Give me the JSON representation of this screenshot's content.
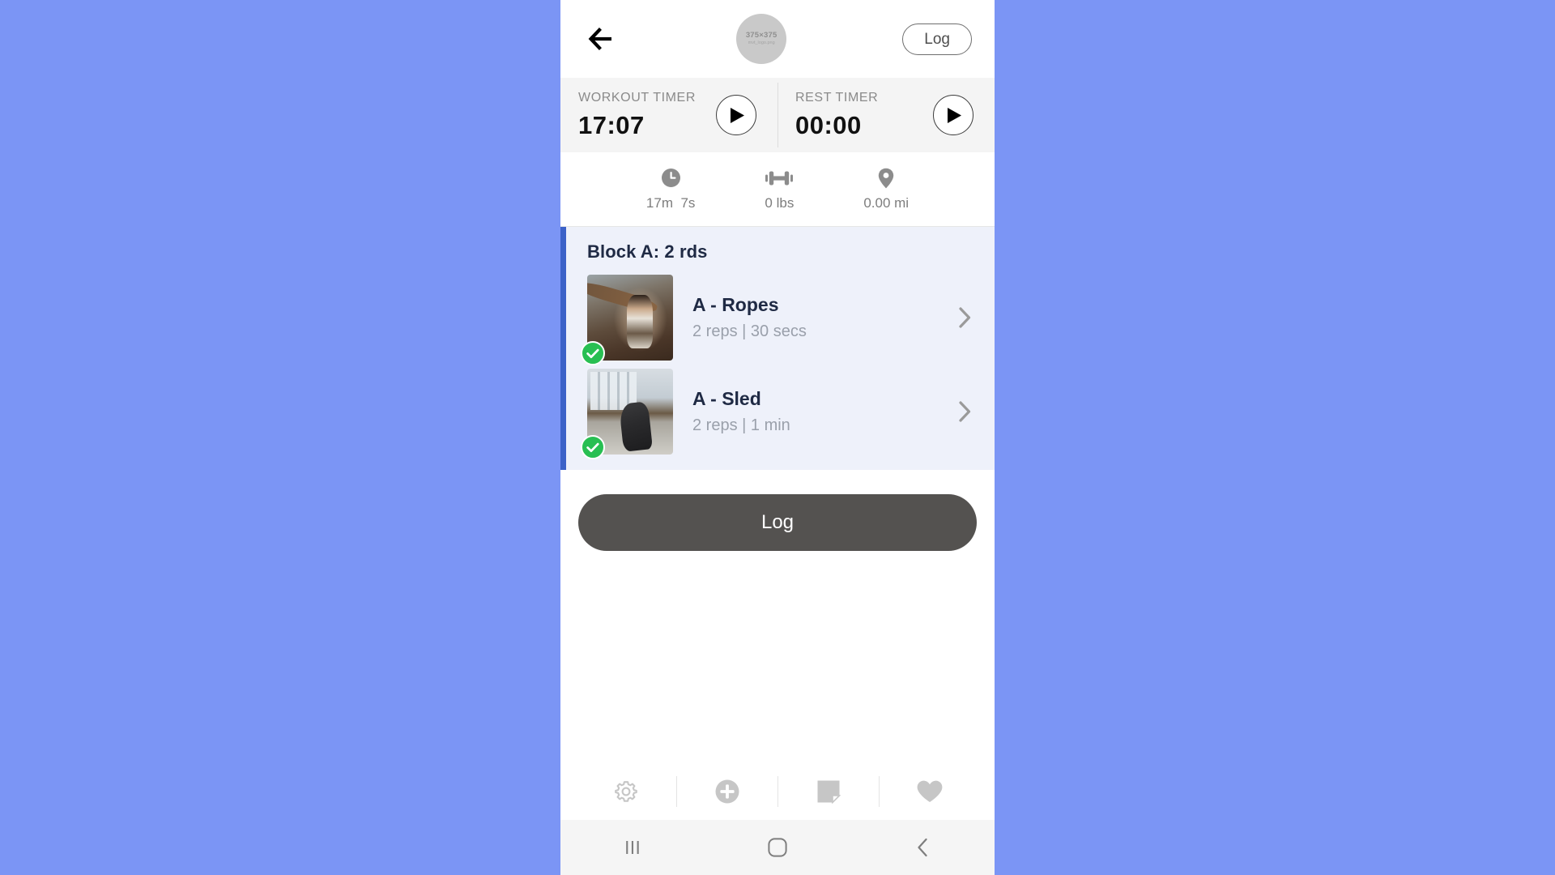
{
  "header": {
    "back_icon": "arrow-left-icon",
    "logo": {
      "dimensions": "375×375",
      "filename": "mvt_logo.png"
    },
    "log_label": "Log"
  },
  "timers": [
    {
      "label": "WORKOUT TIMER",
      "value": "17:07",
      "play_icon": "play-icon"
    },
    {
      "label": "REST TIMER",
      "value": "00:00",
      "play_icon": "play-icon"
    }
  ],
  "stats": [
    {
      "icon": "clock-icon",
      "value": "17m  7s"
    },
    {
      "icon": "dumbbell-icon",
      "value": "0 lbs"
    },
    {
      "icon": "location-pin-icon",
      "value": "0.00 mi"
    }
  ],
  "block": {
    "title": "Block A: 2 rds",
    "accent_color": "#3c62c8",
    "background_color": "#eef1fa",
    "exercises": [
      {
        "name": "A - Ropes",
        "meta": "2 reps | 30 secs",
        "completed": true,
        "thumbnail": "battle-ropes-thumbnail",
        "chevron": "chevron-right-icon"
      },
      {
        "name": "A - Sled",
        "meta": "2 reps | 1 min",
        "completed": true,
        "thumbnail": "sled-push-thumbnail",
        "chevron": "chevron-right-icon"
      }
    ]
  },
  "primary_action": {
    "label": "Log",
    "color": "#545250"
  },
  "toolbar": [
    {
      "icon": "gear-icon",
      "name": "settings"
    },
    {
      "icon": "plus-circle-icon",
      "name": "add"
    },
    {
      "icon": "note-icon",
      "name": "notes"
    },
    {
      "icon": "heart-icon",
      "name": "favorite"
    }
  ],
  "nav_bar": [
    {
      "icon": "recents-icon",
      "name": "recents"
    },
    {
      "icon": "home-icon",
      "name": "home"
    },
    {
      "icon": "back-icon",
      "name": "back"
    }
  ],
  "colors": {
    "page_background": "#7b95f5",
    "check_green": "#28bf52",
    "block_accent": "#3c62c8"
  }
}
